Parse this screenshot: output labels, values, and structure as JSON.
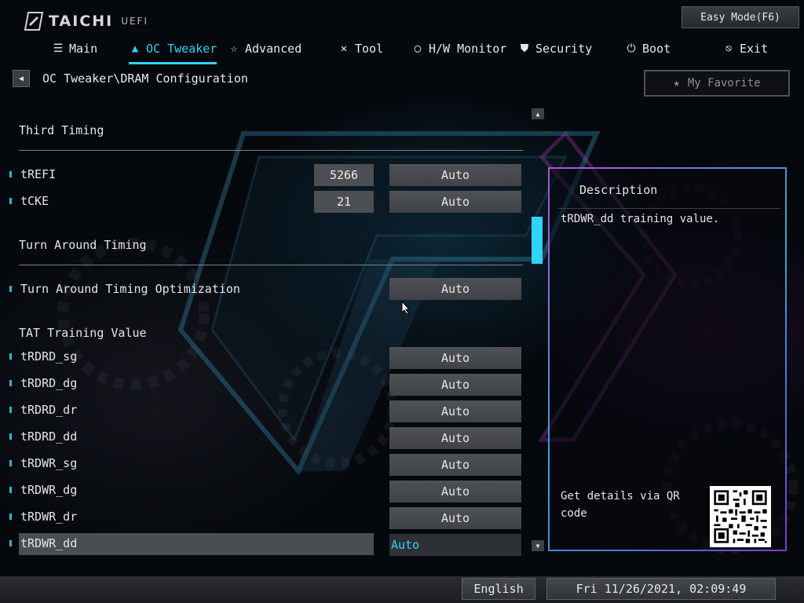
{
  "header": {
    "logo_text": "TAICHI",
    "logo_sub": "UEFI",
    "easy_mode_label": "Easy Mode(F6)"
  },
  "nav": {
    "items": [
      {
        "label": "Main",
        "icon": "list-icon"
      },
      {
        "label": "OC Tweaker",
        "icon": "rocket-icon"
      },
      {
        "label": "Advanced",
        "icon": "star-icon"
      },
      {
        "label": "Tool",
        "icon": "tools-icon"
      },
      {
        "label": "H/W Monitor",
        "icon": "monitor-icon"
      },
      {
        "label": "Security",
        "icon": "shield-icon"
      },
      {
        "label": "Boot",
        "icon": "power-icon"
      },
      {
        "label": "Exit",
        "icon": "exit-icon"
      }
    ],
    "active": "OC Tweaker"
  },
  "breadcrumb": "OC Tweaker\\DRAM Configuration",
  "favorite_label": "My Favorite",
  "sections": {
    "third_timing": "Third Timing",
    "turn_around": "Turn Around Timing",
    "tat_training": "TAT Training Value"
  },
  "settings": [
    {
      "label": "tREFI",
      "number": "5266",
      "value": "Auto"
    },
    {
      "label": "tCKE",
      "number": "21",
      "value": "Auto"
    },
    {
      "label": "Turn Around Timing Optimization",
      "value": "Auto"
    },
    {
      "label": "tRDRD_sg",
      "value": "Auto"
    },
    {
      "label": "tRDRD_dg",
      "value": "Auto"
    },
    {
      "label": "tRDRD_dr",
      "value": "Auto"
    },
    {
      "label": "tRDRD_dd",
      "value": "Auto"
    },
    {
      "label": "tRDWR_sg",
      "value": "Auto"
    },
    {
      "label": "tRDWR_dg",
      "value": "Auto"
    },
    {
      "label": "tRDWR_dr",
      "value": "Auto"
    },
    {
      "label": "tRDWR_dd",
      "value": "Auto"
    }
  ],
  "description": {
    "title": "Description",
    "text": "tRDWR_dd training value.",
    "qr_text": "Get details via QR code"
  },
  "footer": {
    "language": "English",
    "datetime": "Fri 11/26/2021, 02:09:49"
  },
  "colors": {
    "accent": "#2fd3f5",
    "panel_border_start": "#b24fd8",
    "panel_border_end": "#2fa8d6"
  }
}
